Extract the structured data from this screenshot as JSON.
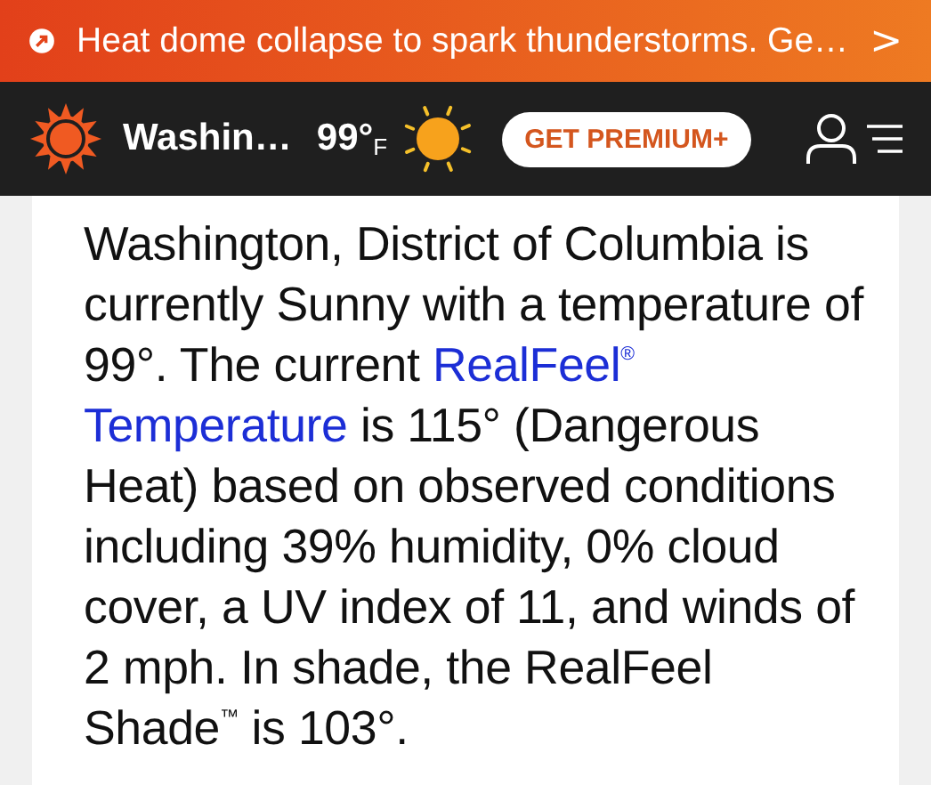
{
  "alert_banner": {
    "text": "Heat dome collapse to spark thunderstorms. Ge…",
    "chevron": ">"
  },
  "header": {
    "location": "Washin…",
    "temperature": "99°",
    "unit": "F",
    "premium_button": "GET PREMIUM+"
  },
  "summary": [
    {
      "kind": "text",
      "text": "Washington, District of Columbia is currently Sunny with a temperature of 99°. The current "
    },
    {
      "kind": "link",
      "text": "RealFeel$^{®}$"
    },
    {
      "kind": "link",
      "text": "Temperature"
    },
    {
      "kind": "text",
      "text": " is 115° (Dangerous Heat) based on observed conditions including 39% humidity, 0% cloud cover, a UV index of 11, and winds of 2 mph. In shade, the RealFeel Shade$^{™}$ is 103°."
    }
  ]
}
